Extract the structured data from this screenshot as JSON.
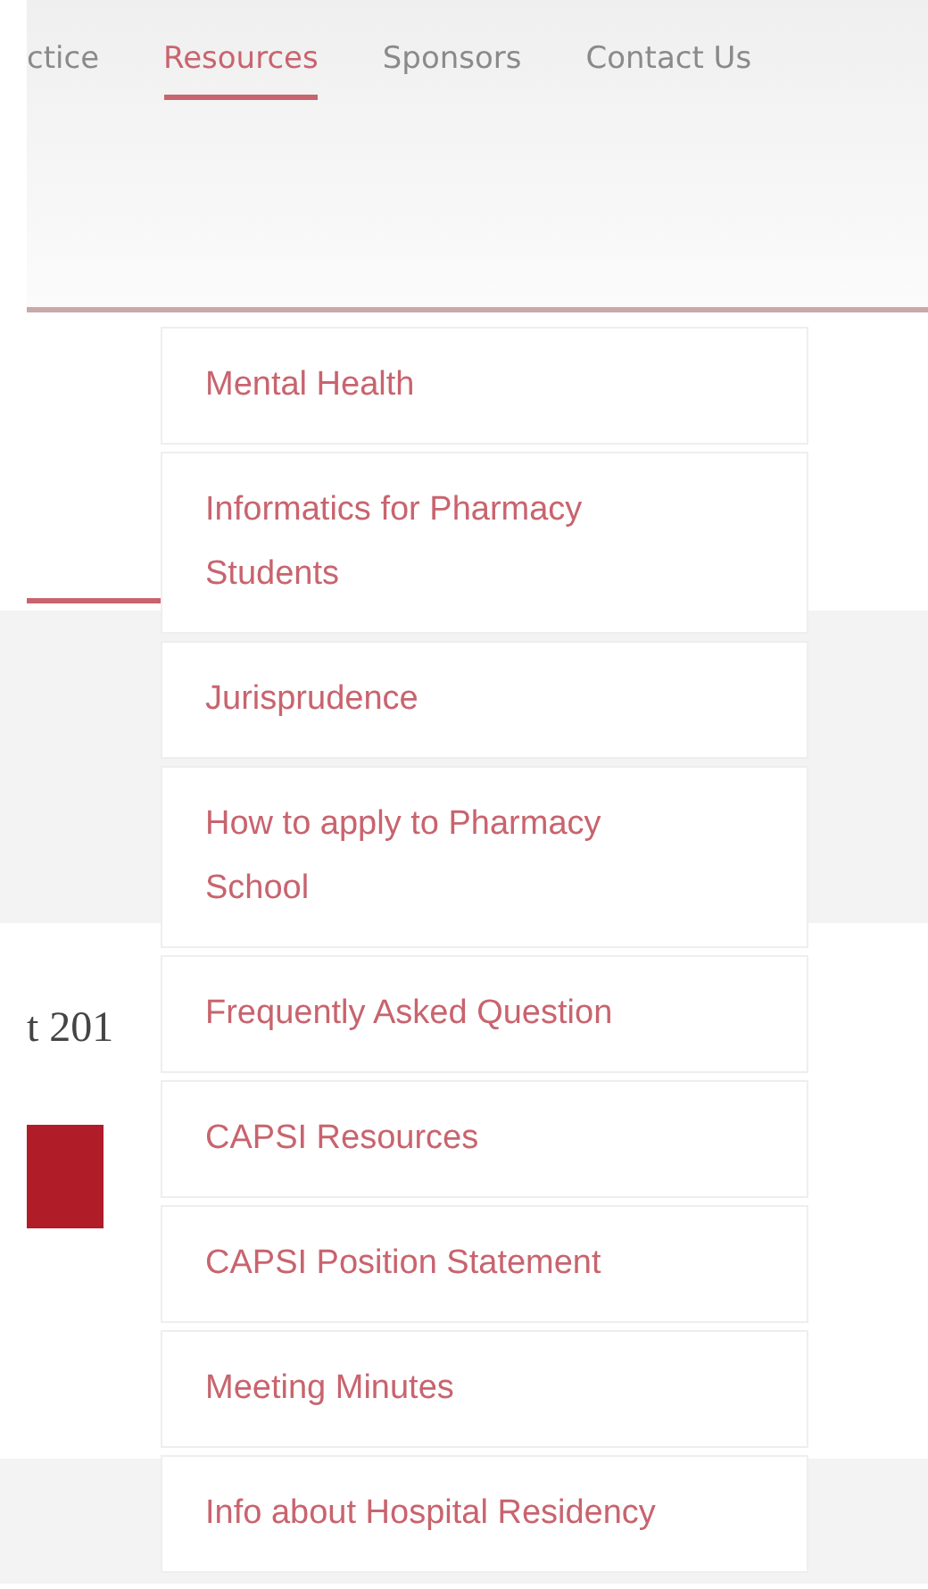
{
  "nav": {
    "items": [
      {
        "label": "ctice",
        "selected": false
      },
      {
        "label": "Resources",
        "selected": true
      },
      {
        "label": "Sponsors",
        "selected": false
      },
      {
        "label": "Contact Us",
        "selected": false
      }
    ]
  },
  "dropdown": {
    "items": [
      "Mental Health",
      "Informatics for Pharmacy Students",
      "Jurisprudence",
      "How to apply to Pharmacy School",
      "Frequently Asked Question",
      "CAPSI Resources",
      "CAPSI Position Statement",
      "Meeting Minutes",
      "Info about Hospital Residency"
    ]
  },
  "page": {
    "heading": "t 201"
  }
}
